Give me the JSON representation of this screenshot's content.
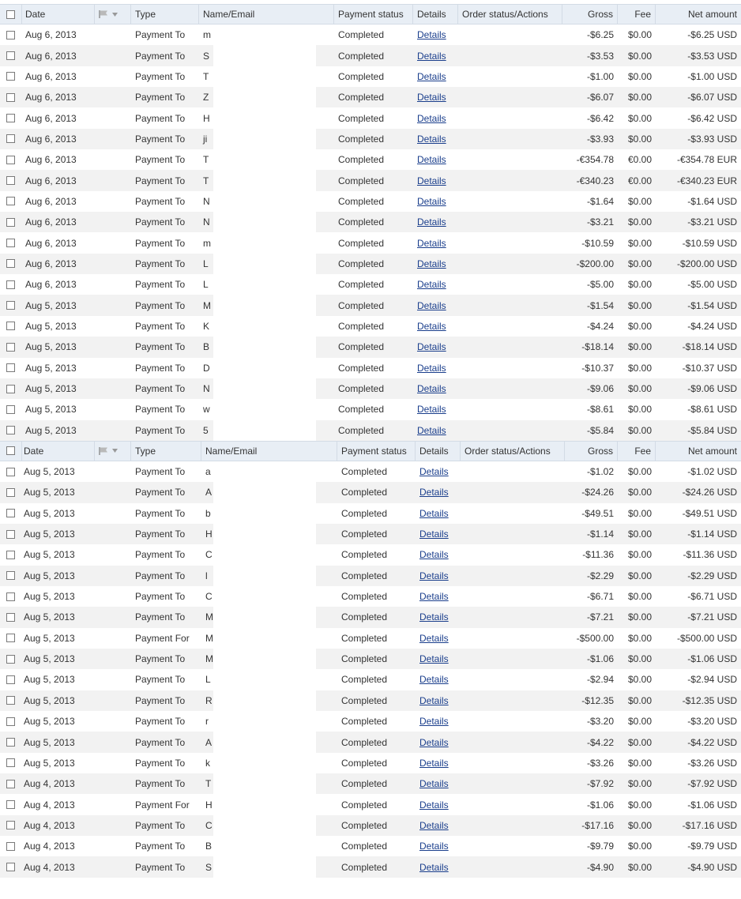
{
  "headers": {
    "date": "Date",
    "type": "Type",
    "name_email": "Name/Email",
    "payment_status": "Payment status",
    "details": "Details",
    "order_status": "Order status/Actions",
    "gross": "Gross",
    "fee": "Fee",
    "net": "Net amount"
  },
  "tables": [
    {
      "rows": [
        {
          "date": "Aug 6, 2013",
          "type": "Payment To",
          "name": "m",
          "status": "Completed",
          "details": "Details",
          "gross": "-$6.25",
          "fee": "$0.00",
          "net": "-$6.25 USD"
        },
        {
          "date": "Aug 6, 2013",
          "type": "Payment To",
          "name": "S",
          "status": "Completed",
          "details": "Details",
          "gross": "-$3.53",
          "fee": "$0.00",
          "net": "-$3.53 USD"
        },
        {
          "date": "Aug 6, 2013",
          "type": "Payment To",
          "name": "T",
          "status": "Completed",
          "details": "Details",
          "gross": "-$1.00",
          "fee": "$0.00",
          "net": "-$1.00 USD"
        },
        {
          "date": "Aug 6, 2013",
          "type": "Payment To",
          "name": "Z",
          "status": "Completed",
          "details": "Details",
          "gross": "-$6.07",
          "fee": "$0.00",
          "net": "-$6.07 USD"
        },
        {
          "date": "Aug 6, 2013",
          "type": "Payment To",
          "name": "H",
          "status": "Completed",
          "details": "Details",
          "gross": "-$6.42",
          "fee": "$0.00",
          "net": "-$6.42 USD"
        },
        {
          "date": "Aug 6, 2013",
          "type": "Payment To",
          "name": "ji",
          "status": "Completed",
          "details": "Details",
          "gross": "-$3.93",
          "fee": "$0.00",
          "net": "-$3.93 USD"
        },
        {
          "date": "Aug 6, 2013",
          "type": "Payment To",
          "name": "T",
          "status": "Completed",
          "details": "Details",
          "gross": "-€354.78",
          "fee": "€0.00",
          "net": "-€354.78 EUR"
        },
        {
          "date": "Aug 6, 2013",
          "type": "Payment To",
          "name": "T",
          "status": "Completed",
          "details": "Details",
          "gross": "-€340.23",
          "fee": "€0.00",
          "net": "-€340.23 EUR"
        },
        {
          "date": "Aug 6, 2013",
          "type": "Payment To",
          "name": "N",
          "status": "Completed",
          "details": "Details",
          "gross": "-$1.64",
          "fee": "$0.00",
          "net": "-$1.64 USD"
        },
        {
          "date": "Aug 6, 2013",
          "type": "Payment To",
          "name": "N",
          "status": "Completed",
          "details": "Details",
          "gross": "-$3.21",
          "fee": "$0.00",
          "net": "-$3.21 USD"
        },
        {
          "date": "Aug 6, 2013",
          "type": "Payment To",
          "name": "m",
          "status": "Completed",
          "details": "Details",
          "gross": "-$10.59",
          "fee": "$0.00",
          "net": "-$10.59 USD"
        },
        {
          "date": "Aug 6, 2013",
          "type": "Payment To",
          "name": "L",
          "status": "Completed",
          "details": "Details",
          "gross": "-$200.00",
          "fee": "$0.00",
          "net": "-$200.00 USD"
        },
        {
          "date": "Aug 6, 2013",
          "type": "Payment To",
          "name": "L",
          "status": "Completed",
          "details": "Details",
          "gross": "-$5.00",
          "fee": "$0.00",
          "net": "-$5.00 USD"
        },
        {
          "date": "Aug 5, 2013",
          "type": "Payment To",
          "name": "M",
          "status": "Completed",
          "details": "Details",
          "gross": "-$1.54",
          "fee": "$0.00",
          "net": "-$1.54 USD"
        },
        {
          "date": "Aug 5, 2013",
          "type": "Payment To",
          "name": "K",
          "status": "Completed",
          "details": "Details",
          "gross": "-$4.24",
          "fee": "$0.00",
          "net": "-$4.24 USD"
        },
        {
          "date": "Aug 5, 2013",
          "type": "Payment To",
          "name": "B",
          "status": "Completed",
          "details": "Details",
          "gross": "-$18.14",
          "fee": "$0.00",
          "net": "-$18.14 USD"
        },
        {
          "date": "Aug 5, 2013",
          "type": "Payment To",
          "name": "D",
          "status": "Completed",
          "details": "Details",
          "gross": "-$10.37",
          "fee": "$0.00",
          "net": "-$10.37 USD"
        },
        {
          "date": "Aug 5, 2013",
          "type": "Payment To",
          "name": "N",
          "status": "Completed",
          "details": "Details",
          "gross": "-$9.06",
          "fee": "$0.00",
          "net": "-$9.06 USD"
        },
        {
          "date": "Aug 5, 2013",
          "type": "Payment To",
          "name": "w",
          "status": "Completed",
          "details": "Details",
          "gross": "-$8.61",
          "fee": "$0.00",
          "net": "-$8.61 USD"
        },
        {
          "date": "Aug 5, 2013",
          "type": "Payment To",
          "name": "5",
          "status": "Completed",
          "details": "Details",
          "gross": "-$5.84",
          "fee": "$0.00",
          "net": "-$5.84 USD"
        }
      ]
    },
    {
      "rows": [
        {
          "date": "Aug 5, 2013",
          "type": "Payment To",
          "name": "a",
          "status": "Completed",
          "details": "Details",
          "gross": "-$1.02",
          "fee": "$0.00",
          "net": "-$1.02 USD"
        },
        {
          "date": "Aug 5, 2013",
          "type": "Payment To",
          "name": "A",
          "status": "Completed",
          "details": "Details",
          "gross": "-$24.26",
          "fee": "$0.00",
          "net": "-$24.26 USD"
        },
        {
          "date": "Aug 5, 2013",
          "type": "Payment To",
          "name": "b",
          "status": "Completed",
          "details": "Details",
          "gross": "-$49.51",
          "fee": "$0.00",
          "net": "-$49.51 USD"
        },
        {
          "date": "Aug 5, 2013",
          "type": "Payment To",
          "name": "H",
          "status": "Completed",
          "details": "Details",
          "gross": "-$1.14",
          "fee": "$0.00",
          "net": "-$1.14 USD"
        },
        {
          "date": "Aug 5, 2013",
          "type": "Payment To",
          "name": "C",
          "status": "Completed",
          "details": "Details",
          "gross": "-$11.36",
          "fee": "$0.00",
          "net": "-$11.36 USD"
        },
        {
          "date": "Aug 5, 2013",
          "type": "Payment To",
          "name": "l",
          "status": "Completed",
          "details": "Details",
          "gross": "-$2.29",
          "fee": "$0.00",
          "net": "-$2.29 USD"
        },
        {
          "date": "Aug 5, 2013",
          "type": "Payment To",
          "name": "C",
          "status": "Completed",
          "details": "Details",
          "gross": "-$6.71",
          "fee": "$0.00",
          "net": "-$6.71 USD"
        },
        {
          "date": "Aug 5, 2013",
          "type": "Payment To",
          "name": "M",
          "status": "Completed",
          "details": "Details",
          "gross": "-$7.21",
          "fee": "$0.00",
          "net": "-$7.21 USD"
        },
        {
          "date": "Aug 5, 2013",
          "type": "Payment For",
          "name": "M",
          "status": "Completed",
          "details": "Details",
          "gross": "-$500.00",
          "fee": "$0.00",
          "net": "-$500.00 USD"
        },
        {
          "date": "Aug 5, 2013",
          "type": "Payment To",
          "name": "M",
          "status": "Completed",
          "details": "Details",
          "gross": "-$1.06",
          "fee": "$0.00",
          "net": "-$1.06 USD"
        },
        {
          "date": "Aug 5, 2013",
          "type": "Payment To",
          "name": "L",
          "status": "Completed",
          "details": "Details",
          "gross": "-$2.94",
          "fee": "$0.00",
          "net": "-$2.94 USD"
        },
        {
          "date": "Aug 5, 2013",
          "type": "Payment To",
          "name": "R",
          "status": "Completed",
          "details": "Details",
          "gross": "-$12.35",
          "fee": "$0.00",
          "net": "-$12.35 USD"
        },
        {
          "date": "Aug 5, 2013",
          "type": "Payment To",
          "name": "r",
          "status": "Completed",
          "details": "Details",
          "gross": "-$3.20",
          "fee": "$0.00",
          "net": "-$3.20 USD"
        },
        {
          "date": "Aug 5, 2013",
          "type": "Payment To",
          "name": "A",
          "status": "Completed",
          "details": "Details",
          "gross": "-$4.22",
          "fee": "$0.00",
          "net": "-$4.22 USD"
        },
        {
          "date": "Aug 5, 2013",
          "type": "Payment To",
          "name": "k",
          "status": "Completed",
          "details": "Details",
          "gross": "-$3.26",
          "fee": "$0.00",
          "net": "-$3.26 USD"
        },
        {
          "date": "Aug 4, 2013",
          "type": "Payment To",
          "name": "T",
          "status": "Completed",
          "details": "Details",
          "gross": "-$7.92",
          "fee": "$0.00",
          "net": "-$7.92 USD"
        },
        {
          "date": "Aug 4, 2013",
          "type": "Payment For",
          "name": "H",
          "status": "Completed",
          "details": "Details",
          "gross": "-$1.06",
          "fee": "$0.00",
          "net": "-$1.06 USD"
        },
        {
          "date": "Aug 4, 2013",
          "type": "Payment To",
          "name": "C",
          "status": "Completed",
          "details": "Details",
          "gross": "-$17.16",
          "fee": "$0.00",
          "net": "-$17.16 USD"
        },
        {
          "date": "Aug 4, 2013",
          "type": "Payment To",
          "name": "B",
          "status": "Completed",
          "details": "Details",
          "gross": "-$9.79",
          "fee": "$0.00",
          "net": "-$9.79 USD"
        },
        {
          "date": "Aug 4, 2013",
          "type": "Payment To",
          "name": "S",
          "status": "Completed",
          "details": "Details",
          "gross": "-$4.90",
          "fee": "$0.00",
          "net": "-$4.90 USD"
        }
      ]
    }
  ]
}
